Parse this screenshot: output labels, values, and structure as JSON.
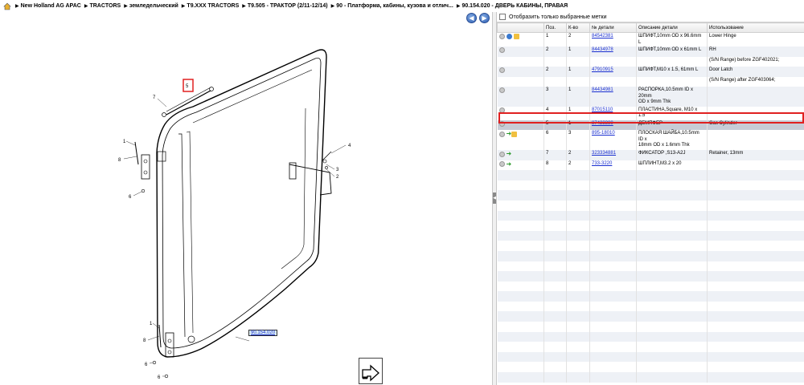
{
  "breadcrumb": {
    "items": [
      "New Holland AG APAC",
      "TRACTORS",
      "земледельческий",
      "T9.XXX TRACTORS",
      "T9.505 - ТРАКТОР (2/11-12/14)",
      "90 - Платформа, кабины, кузова и отлич...",
      "90.154.020 - ДВЕРЬ КАБИНЫ, ПРАВАЯ"
    ]
  },
  "filter": {
    "label": "Отобразить только выбранные метки"
  },
  "table": {
    "headers": [
      "Поз.",
      "К-во",
      "№ детали",
      "Описание детали",
      "Использование"
    ],
    "rows": [
      {
        "pos": "1",
        "qty": "2",
        "part": "84542381",
        "desc": "ШПИФТ,10mm OD x 96.6mm L",
        "usage": "Lower Hinge"
      },
      {
        "pos": "2",
        "qty": "1",
        "part": "84434978",
        "desc": "ШПИФТ,10mm OD x 61mm L",
        "usage": "RH"
      },
      {
        "pos": "",
        "qty": "",
        "part": "",
        "desc": "",
        "usage": "(S/N Range) before ZGF402021;"
      },
      {
        "pos": "2",
        "qty": "1",
        "part": "47910915",
        "desc": "ШПИФТ,M10 x 1.5, 61mm L",
        "usage": "Door Latch"
      },
      {
        "pos": "",
        "qty": "",
        "part": "",
        "desc": "",
        "usage": "(S/N Range) after ZGF403064;"
      },
      {
        "pos": "3",
        "qty": "1",
        "part": "84434981",
        "desc": "РАСПОРКА,10.5mm ID x 20mm",
        "desc2": "OD x 9mm Thk",
        "usage": ""
      },
      {
        "pos": "4",
        "qty": "1",
        "part": "87015110",
        "desc": "ПЛАСТИНА,Square, M10 x 1.5",
        "usage": ""
      },
      {
        "pos": "5",
        "qty": "1",
        "part": "87423389",
        "desc": "ДЕМПФЕР",
        "usage": "Gas Cylinder"
      },
      {
        "pos": "6",
        "qty": "3",
        "part": "895-18010",
        "desc": "ПЛОСКАЯ ШАЙБА,10.5mm ID x",
        "desc2": "18mm OD x 1.6mm Thk",
        "usage": ""
      },
      {
        "pos": "7",
        "qty": "2",
        "part": "323334881",
        "desc": "ФИКСАТОР ,S13-A2J",
        "usage": "Retainer, 13mm"
      },
      {
        "pos": "8",
        "qty": "2",
        "part": "733-3220",
        "desc": "ШПЛИНТ,M3.2 x 20",
        "usage": ""
      }
    ]
  },
  "diagram": {
    "ref_label": "90.154.020",
    "callouts": [
      "7",
      "5",
      "1",
      "8",
      "6",
      "4",
      "3",
      "2",
      "1",
      "8",
      "6",
      "6"
    ]
  }
}
